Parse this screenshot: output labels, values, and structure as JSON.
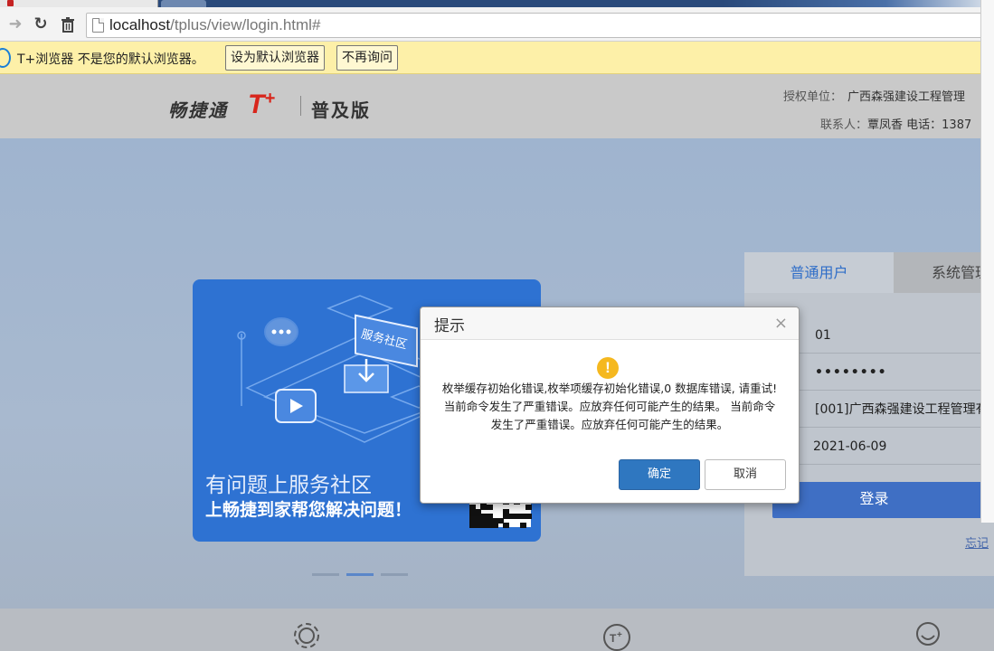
{
  "browser": {
    "url_host": "localhost",
    "url_path": "/tplus/view/login.html#"
  },
  "infobar": {
    "message": "T+浏览器 不是您的默认浏览器。",
    "set_default_label": "设为默认浏览器",
    "dont_ask_label": "不再询问"
  },
  "header": {
    "logo_cn": "畅捷通",
    "logo_brand": "T",
    "logo_plus": "+",
    "edition": "普及版",
    "licensee_label": "授权单位：",
    "licensee_value": "广西森强建设工程管理",
    "contact_label": "联系人：",
    "contact_value": "覃凤香 电话：1387"
  },
  "banner": {
    "illustration_text": "服务社区",
    "line1": "有问题上服务社区",
    "line2": "上畅捷到家帮您解决问题！"
  },
  "login": {
    "tab_normal": "普通用户",
    "tab_admin": "系统管理",
    "username": "01",
    "password": "••••••••",
    "account": "[001]广西森强建设工程管理有",
    "date": "2021-06-09",
    "login_button": "登录",
    "forgot": "忘记"
  },
  "dialog": {
    "title": "提示",
    "close": "×",
    "warn_glyph": "!",
    "message": "枚举缓存初始化错误,枚举项缓存初始化错误,0 数据库错误, 请重试! 当前命令发生了严重错误。应放弃任何可能产生的结果。 当前命令发生了严重错误。应放弃任何可能产生的结果。",
    "ok_label": "确定",
    "cancel_label": "取消"
  },
  "colors": {
    "accent": "#2f77c0",
    "banner": "#2e72d2",
    "brand_red": "#d8261c",
    "infobar": "#fdf0a8",
    "warning": "#f5b81f"
  }
}
